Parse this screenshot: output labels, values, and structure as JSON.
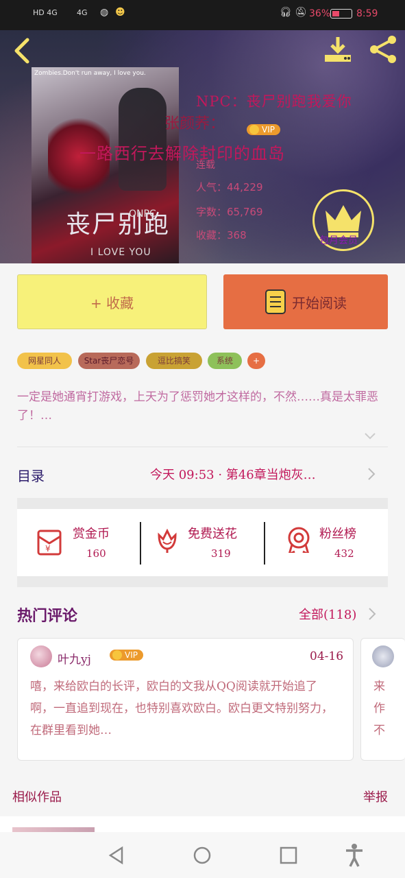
{
  "status_bar": {
    "network_left": "HD 4G",
    "network_right": "4G",
    "battery_pct": "36%",
    "time": "8:59"
  },
  "book": {
    "cover_tagline": "Zombies.Don't run away, I love you.",
    "cover_title": "丧尸别跑",
    "cover_subtitle": "I LOVE YOU",
    "cover_corner": "ONPC",
    "title": "NPC：丧尸别跑我爱你",
    "author": "张颜荞：",
    "author_tag": "VIP",
    "subtitle_overlay": "一路西行去解除封印的血岛",
    "status": "连载",
    "popularity_label": "人气：",
    "popularity": "44,229",
    "words_label": "字数：",
    "words": "65,769",
    "favorites_label": "收藏：",
    "favorites": "368",
    "member_label": "包月会员"
  },
  "actions": {
    "collect": "+ 收藏",
    "read": "开始阅读"
  },
  "tags": [
    "网星同人",
    "Star丧尸恋号",
    "逗比搞笑",
    "系统",
    "+"
  ],
  "description": "一定是她通宵打游戏，上天为了惩罚她才这样的，不然……真是太罪恶了！…",
  "toc": {
    "label": "目录",
    "latest": "今天 09:53 · 第46章当炮灰…"
  },
  "stats": [
    {
      "label": "赏金币",
      "value": "160"
    },
    {
      "label": "免费送花",
      "value": "319"
    },
    {
      "label": "粉丝榜",
      "value": "432"
    }
  ],
  "comments": {
    "title": "热门评论",
    "all_label": "全部(118)",
    "items": [
      {
        "user": "叶九yj",
        "badge": "VIP",
        "date": "04-16",
        "text": "嘻，来给欧白的长评，欧白的文我从QQ阅读就开始追了啊，一直追到现在，也特别喜欢欧白。欧白更文特别努力，在群里看到她…"
      },
      {
        "text": "来作不"
      }
    ]
  },
  "similar": {
    "title": "相似作品",
    "report": "举报"
  },
  "colors": {
    "accent_red": "#c2185b",
    "collect_bg": "#f7f17a",
    "read_bg": "#e66e43",
    "vip": "#ec9a2c",
    "crown": "#f5e26a"
  }
}
